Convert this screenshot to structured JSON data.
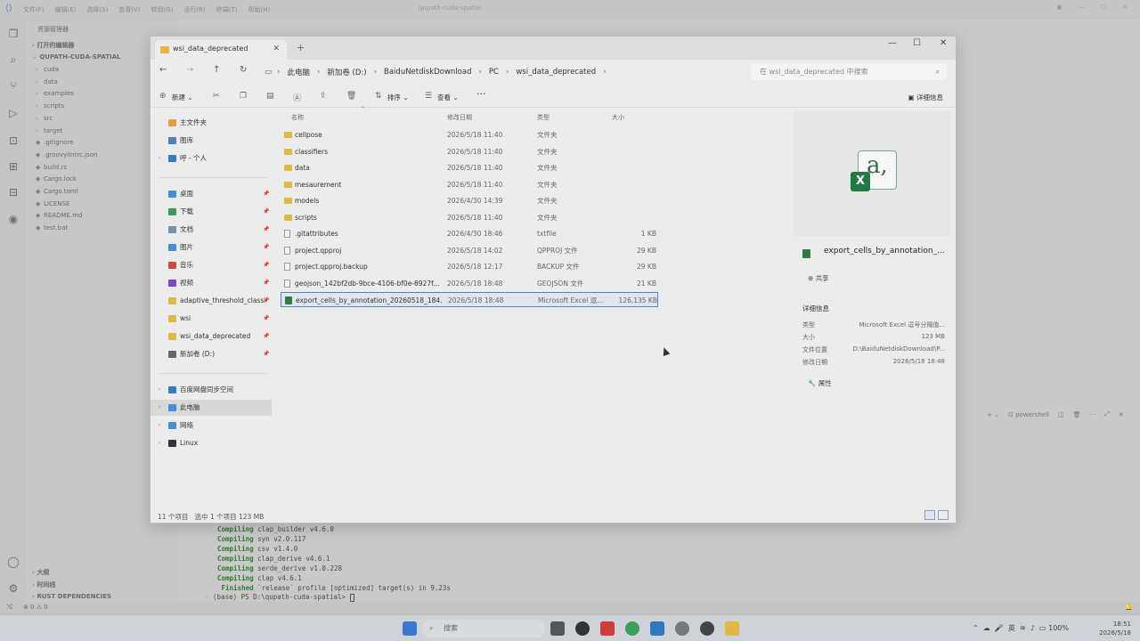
{
  "vscode": {
    "menus": [
      "文件(F)",
      "编辑(E)",
      "选择(S)",
      "查看(V)",
      "转到(G)",
      "运行(R)",
      "终端(T)",
      "帮助(H)"
    ],
    "search": "qupath-cuda-spatial",
    "explorer_title": "资源管理器",
    "open_editors": "打开的编辑器",
    "project": "QUPATH-CUDA-SPATIAL",
    "tree": [
      {
        "label": "cuda",
        "folder": true
      },
      {
        "label": "data",
        "folder": true
      },
      {
        "label": "examples",
        "folder": true
      },
      {
        "label": "scripts",
        "folder": true
      },
      {
        "label": "src",
        "folder": true
      },
      {
        "label": "target",
        "folder": true
      },
      {
        "label": ".gitignore",
        "folder": false
      },
      {
        "label": ".groovylintrc.json",
        "folder": false
      },
      {
        "label": "build.rs",
        "folder": false
      },
      {
        "label": "Cargo.lock",
        "folder": false
      },
      {
        "label": "Cargo.toml",
        "folder": false
      },
      {
        "label": "LICENSE",
        "folder": false
      },
      {
        "label": "README.md",
        "folder": false
      },
      {
        "label": "test.bat",
        "folder": false
      }
    ],
    "outline": "大纲",
    "timeline": "时间线",
    "rust_deps": "RUST DEPENDENCIES",
    "terminal_lines": [
      {
        "kw": "Compiling",
        "rest": " clap_builder v4.6.0"
      },
      {
        "kw": "Compiling",
        "rest": " syn v2.0.117"
      },
      {
        "kw": "Compiling",
        "rest": " csv v1.4.0"
      },
      {
        "kw": "Compiling",
        "rest": " clap_derive v4.6.1"
      },
      {
        "kw": "Compiling",
        "rest": " serde_derive v1.0.228"
      },
      {
        "kw": "Compiling",
        "rest": " clap v4.6.1"
      },
      {
        "kw": " Finished",
        "rest": " `release` profile [optimized] target(s) in 9.23s"
      }
    ],
    "prompt": "(base) PS D:\\qupath-cuda-spatial> ",
    "terminal_shell": "powershell",
    "status_problems": "⊗ 0 ⚠ 0"
  },
  "window": {
    "tab_title": "wsi_data_deprecated",
    "breadcrumb": [
      "此电脑",
      "新加卷 (D:)",
      "BaiduNetdiskDownload",
      "PC",
      "wsi_data_deprecated"
    ],
    "search_placeholder": "在 wsi_data_deprecated 中搜索",
    "toolbar": {
      "new": "新建",
      "sort": "排序",
      "view": "查看",
      "more": "···",
      "details": "详细信息"
    }
  },
  "nav": {
    "items": [
      {
        "label": "主文件夹",
        "color": "#e0a040",
        "pin": false
      },
      {
        "label": "图库",
        "color": "#4a7fc0",
        "pin": false
      },
      {
        "label": "呼 - 个人",
        "color": "#3a78c8",
        "pin": false,
        "expandable": true
      },
      {
        "label": "桌面",
        "color": "#4a8ad0",
        "pin": true
      },
      {
        "label": "下载",
        "color": "#3a9a5a",
        "pin": true
      },
      {
        "label": "文档",
        "color": "#7a8fa8",
        "pin": true
      },
      {
        "label": "图片",
        "color": "#4a8ad0",
        "pin": true
      },
      {
        "label": "音乐",
        "color": "#d04a3a",
        "pin": true
      },
      {
        "label": "视频",
        "color": "#7a4ac0",
        "pin": true
      },
      {
        "label": "adaptive_threshold_classi",
        "color": "#e2b842",
        "pin": true
      },
      {
        "label": "wsi",
        "color": "#e2b842",
        "pin": true
      },
      {
        "label": "wsi_data_deprecated",
        "color": "#e2b842",
        "pin": true
      },
      {
        "label": "新加卷 (D:)",
        "color": "#666666",
        "pin": true
      },
      {
        "label": "百度网盘同步空间",
        "color": "#3a78c8",
        "pin": false,
        "expandable": true
      },
      {
        "label": "此电脑",
        "color": "#4a8ad0",
        "pin": false,
        "expandable": true,
        "selected": true
      },
      {
        "label": "网络",
        "color": "#4a8ad0",
        "pin": false,
        "expandable": true
      },
      {
        "label": "Linux",
        "color": "#333333",
        "pin": false,
        "expandable": true
      }
    ]
  },
  "files": {
    "headers": {
      "name": "名称",
      "date": "修改日期",
      "type": "类型",
      "size": "大小"
    },
    "rows": [
      {
        "name": "cellpose",
        "date": "2026/5/18 11:40",
        "type": "文件夹",
        "size": "",
        "kind": "folder"
      },
      {
        "name": "classifiers",
        "date": "2026/5/18 11:40",
        "type": "文件夹",
        "size": "",
        "kind": "folder"
      },
      {
        "name": "data",
        "date": "2026/5/18 11:40",
        "type": "文件夹",
        "size": "",
        "kind": "folder"
      },
      {
        "name": "mesaurement",
        "date": "2026/5/18 11:40",
        "type": "文件夹",
        "size": "",
        "kind": "folder"
      },
      {
        "name": "models",
        "date": "2026/4/30 14:39",
        "type": "文件夹",
        "size": "",
        "kind": "folder"
      },
      {
        "name": "scripts",
        "date": "2026/5/18 11:40",
        "type": "文件夹",
        "size": "",
        "kind": "folder"
      },
      {
        "name": ".gitattributes",
        "date": "2026/4/30 18:46",
        "type": "txtfile",
        "size": "1 KB",
        "kind": "file"
      },
      {
        "name": "project.qpproj",
        "date": "2026/5/18 14:02",
        "type": "QPPROJ 文件",
        "size": "29 KB",
        "kind": "file"
      },
      {
        "name": "project.qpproj.backup",
        "date": "2026/5/18 12:17",
        "type": "BACKUP 文件",
        "size": "29 KB",
        "kind": "file"
      },
      {
        "name": "geojson_142bf2db-9bce-4106-bf0e-8927f...",
        "date": "2026/5/18 18:48",
        "type": "GEOJSON 文件",
        "size": "21 KB",
        "kind": "file"
      },
      {
        "name": "export_cells_by_annotation_20260518_184...",
        "date": "2026/5/18 18:48",
        "type": "Microsoft Excel 逗...",
        "size": "126,135 KB",
        "kind": "excel",
        "selected": true
      }
    ]
  },
  "details": {
    "filename": "export_cells_by_annotation_...",
    "share": "共享",
    "section": "详细信息",
    "fields": [
      {
        "k": "类型",
        "v": "Microsoft Excel 逗号分隔值..."
      },
      {
        "k": "大小",
        "v": "123 MB"
      },
      {
        "k": "文件位置",
        "v": "D:\\BaiduNetdiskDownload\\P..."
      },
      {
        "k": "修改日期",
        "v": "2026/5/18 18:48"
      }
    ],
    "properties": "属性"
  },
  "status": {
    "count": "11 个项目",
    "selected": "选中 1 个项目  123 MB"
  },
  "taskbar": {
    "search": "搜索",
    "time": "18:51",
    "date": "2026/5/18",
    "battery": "100%",
    "ime": "英"
  }
}
